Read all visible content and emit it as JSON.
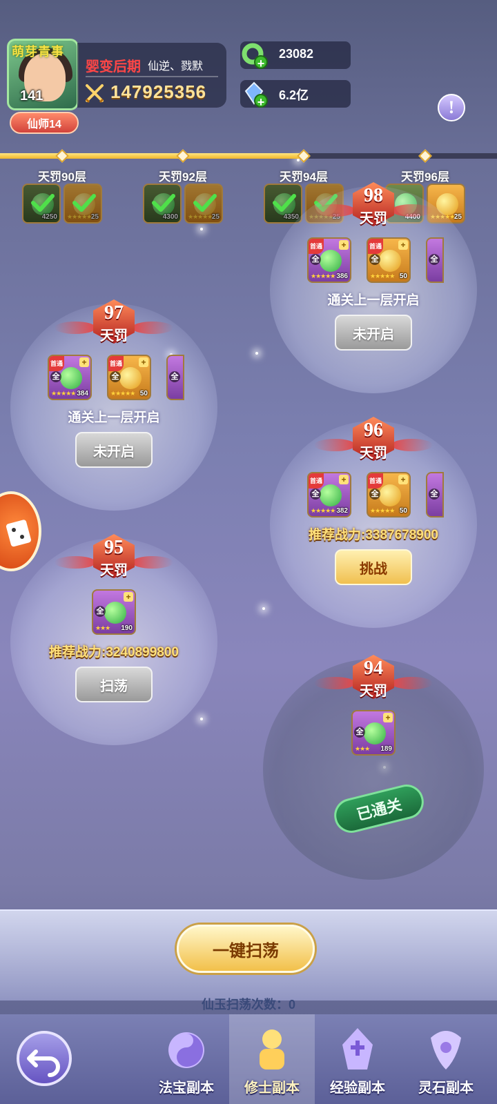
{
  "player": {
    "avatar_title": "萌芽青事",
    "level": "141",
    "realm": "婴变后期",
    "names": "仙逆、戮默",
    "combat_power": "147925356",
    "vip": "仙师14"
  },
  "currencies": [
    {
      "icon": "jade-ring-icon",
      "value": "23082"
    },
    {
      "icon": "crystal-icon",
      "value": "6.2亿"
    }
  ],
  "progress": {
    "fill_fraction": 0.61,
    "milestones": [
      {
        "label": "天罚90层",
        "rewards": [
          {
            "type": "green",
            "count": "4250",
            "claimed": true
          },
          {
            "type": "gold",
            "count": "25",
            "stars": "★★★★★",
            "claimed": true
          }
        ]
      },
      {
        "label": "天罚92层",
        "rewards": [
          {
            "type": "green",
            "count": "4300",
            "claimed": true
          },
          {
            "type": "gold",
            "count": "25",
            "stars": "★★★★★",
            "claimed": true
          }
        ]
      },
      {
        "label": "天罚94层",
        "rewards": [
          {
            "type": "green",
            "count": "4350",
            "claimed": true
          },
          {
            "type": "gold",
            "count": "25",
            "stars": "★★★★★",
            "claimed": true
          }
        ]
      },
      {
        "label": "天罚96层",
        "rewards": [
          {
            "type": "green",
            "count": "4400",
            "claimed": false
          },
          {
            "type": "gold",
            "count": "25",
            "stars": "★★★★★",
            "claimed": false
          }
        ]
      }
    ]
  },
  "stages": [
    {
      "num": "98",
      "word": "天罚",
      "rewards": [
        {
          "count": "386"
        },
        {
          "count": "50"
        }
      ],
      "status_text": "通关上一层开启",
      "button": "未开启"
    },
    {
      "num": "97",
      "word": "天罚",
      "rewards": [
        {
          "count": "384"
        },
        {
          "count": "50"
        }
      ],
      "status_text": "通关上一层开启",
      "button": "未开启"
    },
    {
      "num": "96",
      "word": "天罚",
      "rewards": [
        {
          "count": "382"
        },
        {
          "count": "50"
        }
      ],
      "status_text": "推荐战力:3387678900",
      "button": "挑战"
    },
    {
      "num": "95",
      "word": "天罚",
      "rewards": [
        {
          "count": "190"
        }
      ],
      "status_text": "推荐战力:3240899800",
      "button": "扫荡"
    },
    {
      "num": "94",
      "word": "天罚",
      "rewards": [
        {
          "count": "189"
        }
      ],
      "status_text": "",
      "button": "已通关"
    }
  ],
  "reward_tags": {
    "all": "全",
    "first": "首通",
    "plus": "+"
  },
  "sweep": {
    "button": "一键扫荡",
    "count_label": "仙玉扫荡次数：",
    "count_value": "0"
  },
  "nav": {
    "items": [
      {
        "label": "法宝副本",
        "icon": "vortex-icon"
      },
      {
        "label": "修士副本",
        "icon": "cultivator-icon"
      },
      {
        "label": "经验副本",
        "icon": "exp-tower-icon"
      },
      {
        "label": "灵石副本",
        "icon": "spirit-stone-icon"
      }
    ],
    "active": "修士副本"
  },
  "colors": {
    "accent_gold": "#f0c050",
    "realm_red": "#ff4646",
    "power_gold": "#ffe07a"
  }
}
